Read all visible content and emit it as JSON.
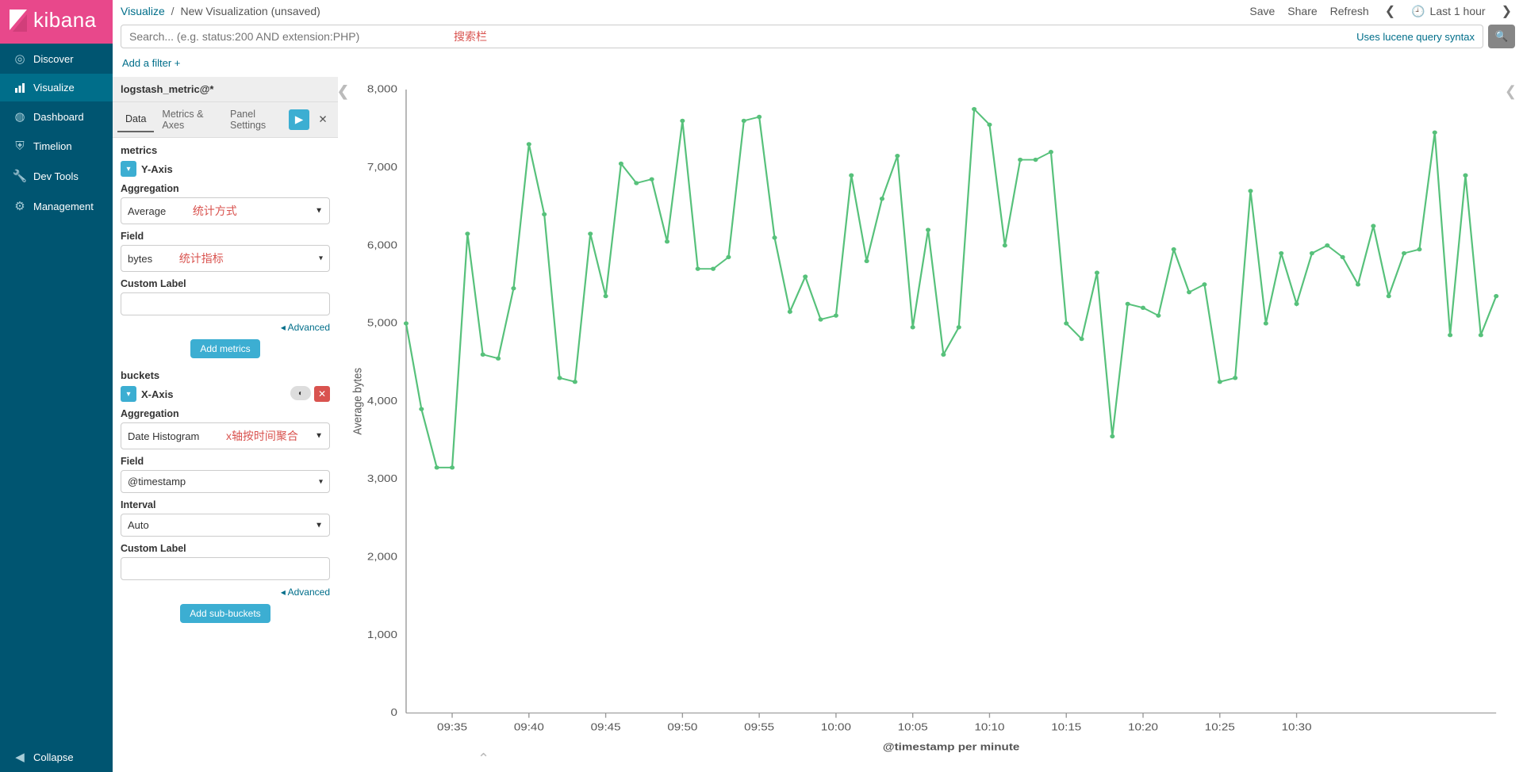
{
  "branding": {
    "name": "kibana"
  },
  "sidebar": {
    "items": [
      {
        "label": "Discover"
      },
      {
        "label": "Visualize"
      },
      {
        "label": "Dashboard"
      },
      {
        "label": "Timelion"
      },
      {
        "label": "Dev Tools"
      },
      {
        "label": "Management"
      }
    ],
    "collapse": "Collapse"
  },
  "breadcrumb": {
    "root": "Visualize",
    "current": "New Visualization (unsaved)"
  },
  "actions": {
    "save": "Save",
    "share": "Share",
    "refresh": "Refresh",
    "timerange": "Last 1 hour"
  },
  "search": {
    "placeholder": "Search... (e.g. status:200 AND extension:PHP)",
    "syntax_link": "Uses lucene query syntax",
    "annotation": "搜索栏"
  },
  "filter": {
    "add": "Add a filter"
  },
  "config": {
    "index_pattern": "logstash_metric@*",
    "tabs": {
      "data": "Data",
      "metrics_axes": "Metrics & Axes",
      "panel": "Panel Settings"
    },
    "sections": {
      "metrics": {
        "title": "metrics",
        "yaxis": "Y-Axis",
        "agg_label": "Aggregation",
        "agg_value": "Average",
        "agg_annot": "统计方式",
        "field_label": "Field",
        "field_value": "bytes",
        "field_annot": "统计指标",
        "custom_label": "Custom Label",
        "advanced": "Advanced",
        "add_metrics": "Add metrics"
      },
      "buckets": {
        "title": "buckets",
        "xaxis": "X-Axis",
        "agg_label": "Aggregation",
        "agg_value": "Date Histogram",
        "agg_annot": "x轴按时间聚合",
        "field_label": "Field",
        "field_value": "@timestamp",
        "interval_label": "Interval",
        "interval_value": "Auto",
        "custom_label": "Custom Label",
        "advanced": "Advanced",
        "add_sub": "Add sub-buckets"
      }
    }
  },
  "chart_data": {
    "type": "line",
    "ylabel": "Average bytes",
    "xlabel": "@timestamp per minute",
    "ylim": [
      0,
      8000
    ],
    "yticks": [
      0,
      1000,
      2000,
      3000,
      4000,
      5000,
      6000,
      7000,
      8000
    ],
    "ytick_labels": [
      "0",
      "1,000",
      "2,000",
      "3,000",
      "4,000",
      "5,000",
      "6,000",
      "7,000",
      "8,000"
    ],
    "xtick_labels": [
      "09:35",
      "09:40",
      "09:45",
      "09:50",
      "09:55",
      "10:00",
      "10:05",
      "10:10",
      "10:15",
      "10:20",
      "10:25",
      "10:30"
    ],
    "xtick_idx": [
      3,
      8,
      13,
      18,
      23,
      28,
      33,
      38,
      43,
      48,
      53,
      58
    ],
    "series": [
      {
        "name": "Average bytes",
        "color": "#57c17b",
        "values": [
          5000,
          3900,
          3150,
          3150,
          6150,
          4600,
          4550,
          5450,
          7300,
          6400,
          4300,
          4250,
          6150,
          5350,
          7050,
          6800,
          6850,
          6050,
          7600,
          5700,
          5700,
          5850,
          7600,
          7650,
          6100,
          5150,
          5600,
          5050,
          5100,
          6900,
          5800,
          6600,
          7150,
          4950,
          6200,
          4600,
          4950,
          7750,
          7550,
          6000,
          7100,
          7100,
          7200,
          5000,
          4800,
          5650,
          3550,
          5250,
          5200,
          5100,
          5950,
          5400,
          5500,
          4250,
          4300,
          6700,
          5000,
          5900,
          5250,
          5900,
          6000,
          5850,
          5500,
          6250,
          5350,
          5900,
          5950,
          7450,
          4850,
          6900,
          4850,
          5350
        ]
      }
    ]
  }
}
